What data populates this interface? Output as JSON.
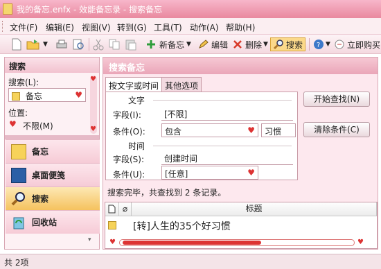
{
  "window": {
    "title": "我的备忘.enfx - 效能备忘录 - 搜索备忘"
  },
  "menu": [
    "文件(F)",
    "编辑(E)",
    "视图(V)",
    "转到(G)",
    "工具(T)",
    "动作(A)",
    "帮助(H)"
  ],
  "toolbar": {
    "new_memo": "新备忘",
    "edit": "编辑",
    "delete": "删除",
    "search": "搜索",
    "buy": "立即购买"
  },
  "left": {
    "header": "搜索",
    "search_label": "搜索(L):",
    "search_value": "备忘",
    "position_label": "位置:",
    "position_option": "不限(M)",
    "nav": [
      "备忘",
      "桌面便笺",
      "搜索",
      "回收站"
    ]
  },
  "main": {
    "header": "搜索备忘",
    "tabs": [
      "按文字或时间",
      "其他选项"
    ],
    "text_group": "文字",
    "field_label": "字段(I):",
    "field_value": "[不限]",
    "condition_label": "条件(O):",
    "condition_value": "包含",
    "condition_text": "习惯",
    "time_group": "时间",
    "time_field_label": "字段(S):",
    "time_field_value": "创建时间",
    "time_condition_label": "条件(U):",
    "time_condition_value": "[任意]",
    "start_button": "开始查找(N)",
    "clear_button": "清除条件(C)",
    "result_text": "搜索完毕，共查找到 2 条记录。",
    "list_header": "标题",
    "rows": [
      "[转]人生的35个好习惯"
    ]
  },
  "status": "共 2项"
}
